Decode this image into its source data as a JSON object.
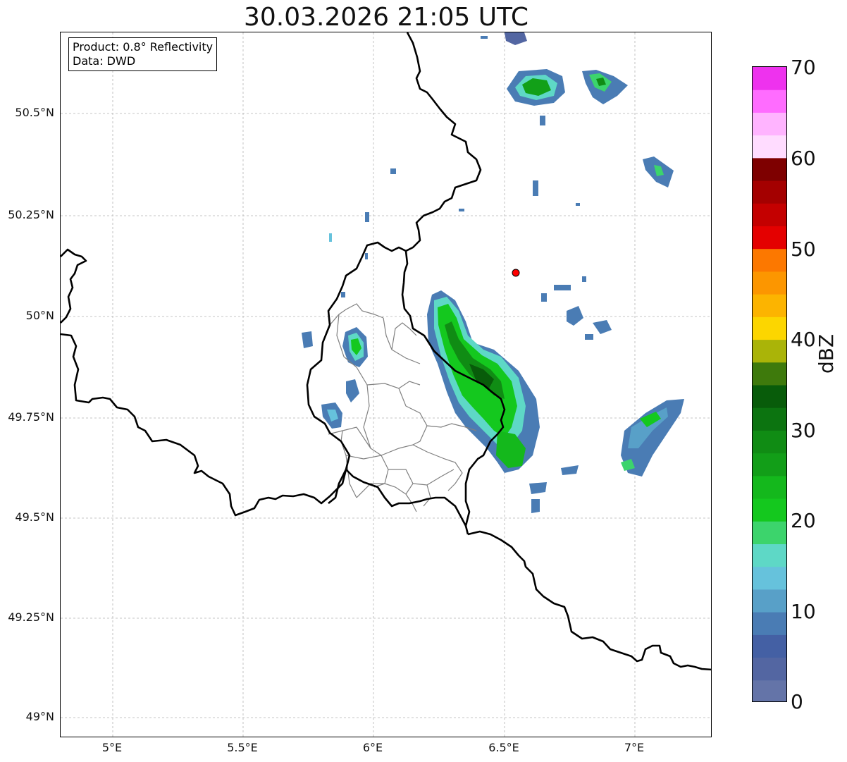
{
  "title": "30.03.2026 21:05 UTC",
  "info": {
    "product": "Product: 0.8° Reflectivity",
    "source": "Data: DWD"
  },
  "axes": {
    "x_ticks": [
      "5°E",
      "5.5°E",
      "6°E",
      "6.5°E",
      "7°E"
    ],
    "y_ticks": [
      "50.5°N",
      "50.25°N",
      "50°N",
      "49.75°N",
      "49.5°N",
      "49.25°N",
      "49°N"
    ]
  },
  "colorbar": {
    "label": "dBZ",
    "ticks": [
      "0",
      "10",
      "20",
      "30",
      "40",
      "50",
      "60",
      "70"
    ],
    "colors": [
      "#6474a8",
      "#5366a2",
      "#4460a4",
      "#4a7cb4",
      "#58a0c8",
      "#66c2dc",
      "#5ed8c6",
      "#3cd46c",
      "#14c81e",
      "#14b81c",
      "#129e18",
      "#108c14",
      "#0c7410",
      "#085c0a",
      "#3e7a0c",
      "#aab408",
      "#fcd600",
      "#fcb400",
      "#fc9600",
      "#fc7800",
      "#e40000",
      "#c40000",
      "#a40000",
      "#7e0000",
      "#ffdcff",
      "#ffb4ff",
      "#ff6cff",
      "#ee32ee"
    ]
  },
  "marker": {
    "name": "Radar location",
    "color": "#ff0000"
  },
  "colors": {
    "border": "#000000",
    "districts": "#808080",
    "grid": "#b4b4b4"
  }
}
